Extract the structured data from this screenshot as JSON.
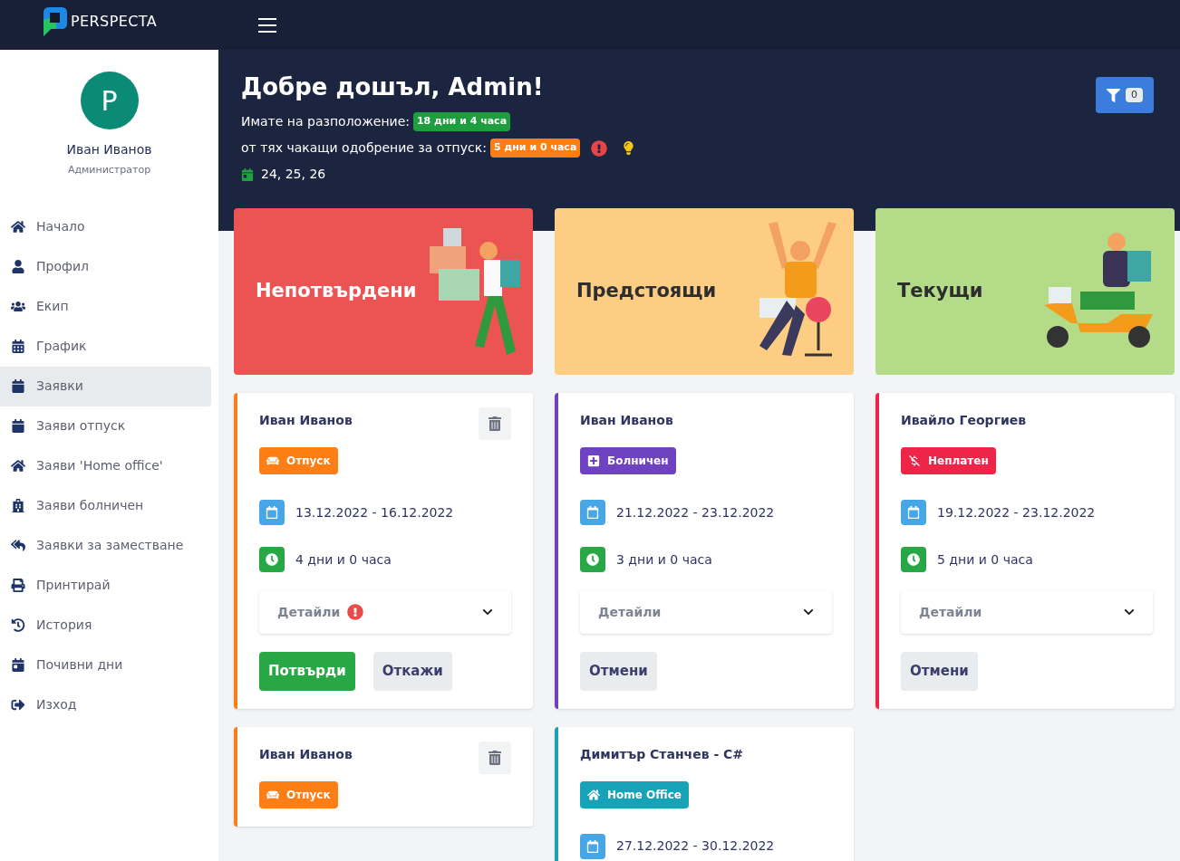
{
  "brand": {
    "name": "PERSPECTA"
  },
  "user": {
    "initial": "P",
    "name": "Иван Иванов",
    "role": "Администратор"
  },
  "sidebar": {
    "items": [
      {
        "label": "Начало",
        "selected": false
      },
      {
        "label": "Профил",
        "selected": false
      },
      {
        "label": "Екип",
        "selected": false
      },
      {
        "label": "График",
        "selected": false
      },
      {
        "label": "Заявки",
        "selected": true
      },
      {
        "label": "Заяви отпуск",
        "selected": false
      },
      {
        "label": "Заяви 'Home office'",
        "selected": false
      },
      {
        "label": "Заяви болничен",
        "selected": false
      },
      {
        "label": "Заявки за заместване",
        "selected": false
      },
      {
        "label": "Принтирай",
        "selected": false
      },
      {
        "label": "История",
        "selected": false
      },
      {
        "label": "Почивни дни",
        "selected": false
      },
      {
        "label": "Изход",
        "selected": false
      }
    ]
  },
  "welcome": {
    "title": "Добре дошъл, Admin!",
    "available_label": "Имате на разположение:",
    "available_value": "18 дни и 4 часа",
    "pending_label": "от тях чакащи одобрение за отпуск:",
    "pending_value": "5 дни и 0 часа",
    "pending_alert": true,
    "pending_hint": true,
    "holidays": "24, 25, 26"
  },
  "filter": {
    "count": "0"
  },
  "columns": [
    {
      "title": "Непотвърдени",
      "color": "#ec5353",
      "requests": [
        {
          "name": "Иван Иванов",
          "deletable": true,
          "badge": {
            "label": "Отпуск",
            "kind": "vacation"
          },
          "dates": "13.12.2022 - 16.12.2022",
          "duration": "4 дни и 0 часа",
          "details": {
            "label": "Детайли",
            "alert": true,
            "expanded": false
          },
          "buttons": [
            {
              "label": "Потвърди",
              "kind": "confirm"
            },
            {
              "label": "Откажи",
              "kind": "secondary"
            }
          ]
        },
        {
          "name": "Иван Иванов",
          "deletable": true,
          "badge": {
            "label": "Отпуск",
            "kind": "vacation"
          }
        }
      ]
    },
    {
      "title": "Предстоящи",
      "color": "#fecd84",
      "requests": [
        {
          "name": "Иван Иванов",
          "deletable": false,
          "badge": {
            "label": "Болничен",
            "kind": "sick"
          },
          "dates": "21.12.2022 - 23.12.2022",
          "duration": "3 дни и 0 часа",
          "details": {
            "label": "Детайли",
            "alert": false,
            "expanded": false
          },
          "buttons": [
            {
              "label": "Отмени",
              "kind": "secondary"
            }
          ]
        },
        {
          "name": "Димитър Станчев - C#",
          "deletable": false,
          "badge": {
            "label": "Home Office",
            "kind": "home"
          },
          "dates": "27.12.2022 - 30.12.2022"
        }
      ]
    },
    {
      "title": "Текущи",
      "color": "#b3db88",
      "requests": [
        {
          "name": "Ивайло Георгиев",
          "deletable": false,
          "badge": {
            "label": "Неплатен",
            "kind": "unpaid"
          },
          "dates": "19.12.2022 - 23.12.2022",
          "duration": "5 дни и 0 часа",
          "details": {
            "label": "Детайли",
            "alert": false,
            "expanded": false
          },
          "buttons": [
            {
              "label": "Отмени",
              "kind": "secondary"
            }
          ]
        }
      ]
    }
  ]
}
